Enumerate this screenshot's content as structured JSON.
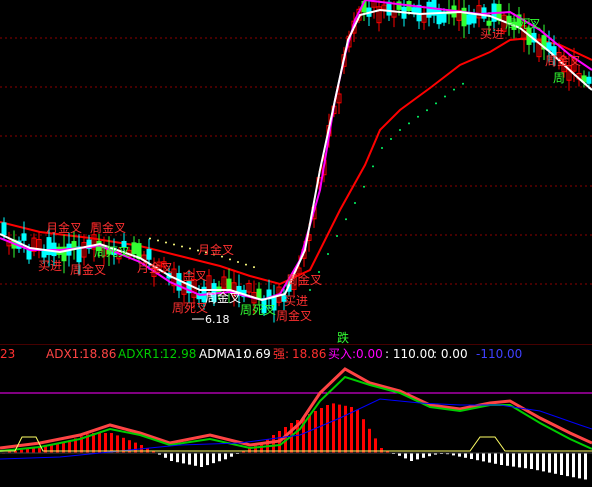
{
  "colors": {
    "background": "#000000",
    "grid": "#8b0000",
    "bull_candle": "#ff0000",
    "bear_candle": "#00ffff",
    "bull_sub_bar": "#ff0000",
    "bear_sub_bar": "#ffffff",
    "ma_white": "#ffffff",
    "ma_magenta": "#ff00ff",
    "ma_red": "#ff0000",
    "sar_dots_green": "#00ff66",
    "sar_dots_yellow": "#ffff80",
    "signal_red": "#ff3030",
    "signal_green": "#33ff33",
    "adx_line": "#ff4444",
    "adxr_line": "#00cc00",
    "adma_line": "#0000ff",
    "yellow_pulse": "#ffff66",
    "magenta_level": "#ff00ff"
  },
  "main_chart": {
    "price_low_label": "6.18",
    "signals": [
      {
        "text": "月金叉",
        "color": "red"
      },
      {
        "text": "周金叉",
        "color": "red"
      },
      {
        "text": "买进",
        "color": "red"
      },
      {
        "text": "周金叉",
        "color": "red"
      },
      {
        "text": "周死叉",
        "color": "green"
      },
      {
        "text": "月金叉",
        "color": "red"
      },
      {
        "text": "金叉",
        "color": "red"
      },
      {
        "text": "周死叉",
        "color": "red"
      },
      {
        "text": "月金叉",
        "color": "red"
      },
      {
        "text": "周金叉",
        "color": "white"
      },
      {
        "text": "周死叉",
        "color": "green"
      },
      {
        "text": "周金叉",
        "color": "red"
      },
      {
        "text": "买进",
        "color": "red"
      },
      {
        "text": "周金叉",
        "color": "red"
      },
      {
        "text": "周死叉",
        "color": "green"
      },
      {
        "text": "买进",
        "color": "red"
      },
      {
        "text": "周金叉",
        "color": "red"
      },
      {
        "text": "周",
        "color": "green"
      }
    ],
    "fall_label": "跌"
  },
  "status_bar": {
    "prefix_value": "23",
    "adx_label": "ADX1:",
    "adx_value": "18.86",
    "adxr_label": "ADXR1:",
    "adxr_value": "12.98",
    "adma_label": "ADMA1:",
    "adma_value": "0.69",
    "strong_label": "强:",
    "strong_value": "18.86",
    "buy_label": "买入:",
    "buy_value": "0.00",
    "level_high": ": 110.00",
    "level_zero": ": 0.00",
    "level_low": "-110.00"
  }
}
